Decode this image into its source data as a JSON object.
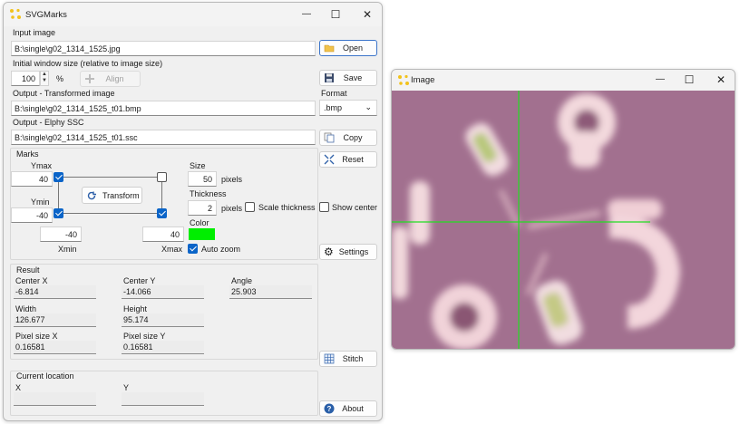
{
  "main_window": {
    "title": "SVGMarks",
    "minimize_glyph": "—",
    "maximize_glyph": "☐",
    "close_glyph": "✕",
    "input_image_label": "Input image",
    "input_image_value": "B:\\single\\g02_1314_1525.jpg",
    "initial_size_label": "Initial window size (relative to image size)",
    "initial_size_value": "100",
    "percent_sign": "%",
    "output_transformed_label": "Output - Transformed image",
    "output_transformed_value": "B:\\single\\g02_1314_1525_t01.bmp",
    "output_elphy_label": "Output - Elphy SSC",
    "output_elphy_value": "B:\\single\\g02_1314_1525_t01.ssc",
    "format_label": "Format",
    "format_value": ".bmp"
  },
  "buttons": {
    "open": "Open",
    "align": "Align",
    "save": "Save",
    "copy": "Copy",
    "reset": "Reset",
    "show_center": "Show center",
    "settings": "Settings",
    "stitch": "Stitch",
    "about": "About",
    "transform": "Transform"
  },
  "marks": {
    "group_label": "Marks",
    "ymax_label": "Ymax",
    "ymax_value": "40",
    "ymin_label": "Ymin",
    "ymin_value": "-40",
    "xmin_label": "Xmin",
    "xmin_value": "-40",
    "xmax_label": "Xmax",
    "xmax_value": "40",
    "size_label": "Size",
    "size_value": "50",
    "size_unit": "pixels",
    "thickness_label": "Thickness",
    "thickness_value": "2",
    "thickness_unit": "pixels",
    "scale_thickness_label": "Scale thickness",
    "color_label": "Color",
    "color_value": "#00ee00",
    "auto_zoom_label": "Auto zoom"
  },
  "result": {
    "group_label": "Result",
    "center_x_label": "Center X",
    "center_x_value": "-6.814",
    "center_y_label": "Center Y",
    "center_y_value": "-14.066",
    "angle_label": "Angle",
    "angle_value": "25.903",
    "width_label": "Width",
    "width_value": "126.677",
    "height_label": "Height",
    "height_value": "95.174",
    "pixel_size_x_label": "Pixel size X",
    "pixel_size_x_value": "0.16581",
    "pixel_size_y_label": "Pixel size Y",
    "pixel_size_y_value": "0.16581"
  },
  "current_location": {
    "group_label": "Current location",
    "x_label": "X",
    "x_value": "",
    "y_label": "Y",
    "y_value": ""
  },
  "image_window": {
    "title": "Image",
    "minimize_glyph": "—",
    "maximize_glyph": "☐",
    "close_glyph": "✕",
    "crosshair_color": "#22dd22",
    "background_color": "#a2708f"
  }
}
